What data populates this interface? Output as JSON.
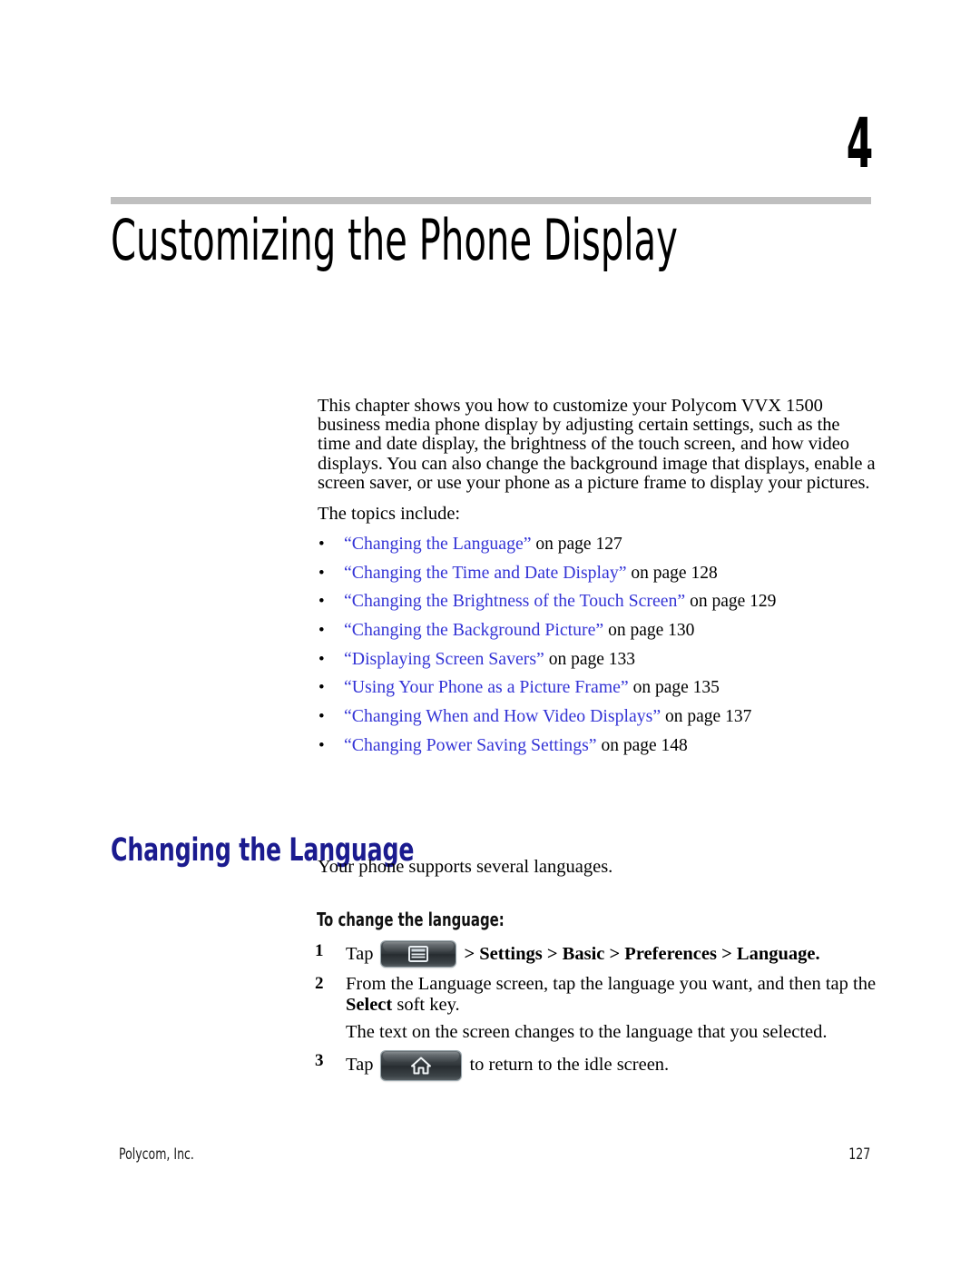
{
  "chapter": {
    "number": "4",
    "title": "Customizing the Phone Display"
  },
  "intro": {
    "paragraph": "This chapter shows you how to customize your Polycom VVX 1500 business media phone display by adjusting certain settings, such as the time and date display, the brightness of the touch screen, and how video displays. You can also change the background image that displays, enable a screen saver, or use your phone as a picture frame to display your pictures.",
    "topics_label": "The topics include:"
  },
  "topics": [
    {
      "bullet": "•",
      "link": "“Changing the Language”",
      "page_ref": "on page 127"
    },
    {
      "bullet": "•",
      "link": "“Changing the Time and Date Display”",
      "page_ref": "on page 128"
    },
    {
      "bullet": "•",
      "link": "“Changing the Brightness of the Touch Screen”",
      "page_ref": "on page 129"
    },
    {
      "bullet": "•",
      "link": "“Changing the Background Picture”",
      "page_ref": "on page 130"
    },
    {
      "bullet": "•",
      "link": "“Displaying Screen Savers”",
      "page_ref": "on page 133"
    },
    {
      "bullet": "•",
      "link": "“Using Your Phone as a Picture Frame”",
      "page_ref": "on page 135"
    },
    {
      "bullet": "•",
      "link": "“Changing When and How Video Displays”",
      "page_ref": "on page 137"
    },
    {
      "bullet": "•",
      "link": "“Changing Power Saving Settings”",
      "page_ref": "on page 148"
    }
  ],
  "section": {
    "heading": "Changing the Language",
    "intro": "Your phone supports several languages.",
    "procedure_heading": "To change the language:"
  },
  "steps": {
    "step1": {
      "number": "1",
      "text_before": "Tap",
      "icon": "menu-key-icon",
      "text_after": "> Settings > Basic > Preferences > Language."
    },
    "step2": {
      "number": "2",
      "line1": "From the Language screen, tap the language you want, and then tap the",
      "bold_word": "Select",
      "line2_rest": "soft key."
    },
    "result_note": "The text on the screen changes to the language that you selected.",
    "step3": {
      "number": "3",
      "text_before": "Tap",
      "icon": "home-key-icon",
      "text_after": "to return to the idle screen."
    }
  },
  "footer": {
    "company": "Polycom, Inc.",
    "page_number": "127"
  },
  "colors": {
    "link_blue": "#3434d6",
    "heading_navy": "#1b1b8f",
    "rule_gray": "#bfbfbf"
  }
}
